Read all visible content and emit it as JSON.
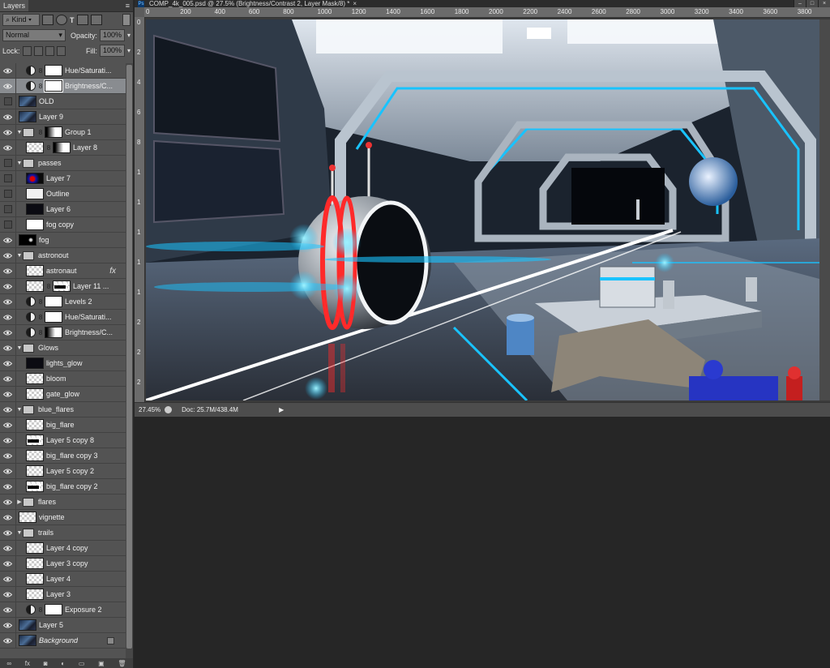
{
  "panel": {
    "tab": "Layers",
    "filter_kind": "Kind",
    "blend_mode": "Normal",
    "opacity_label": "Opacity:",
    "opacity_value": "100%",
    "lock_label": "Lock:",
    "fill_label": "Fill:",
    "fill_value": "100%"
  },
  "layers": [
    {
      "name": "Hue/Saturati...",
      "type": "adjustment",
      "visible": true,
      "indent": 1,
      "thumb": "mask"
    },
    {
      "name": "Brightness/C...",
      "type": "adjustment",
      "visible": true,
      "indent": 1,
      "thumb": "mask-sel",
      "selected": true
    },
    {
      "name": "OLD",
      "type": "pixel",
      "visible": false,
      "indent": 0,
      "thumb": "scene"
    },
    {
      "name": "Layer 9",
      "type": "pixel",
      "visible": true,
      "indent": 0,
      "thumb": "scene"
    },
    {
      "name": "Group 1",
      "type": "group",
      "visible": true,
      "indent": 0,
      "expanded": true,
      "mask": "mask-grad"
    },
    {
      "name": "Layer 8",
      "type": "pixel-masked",
      "visible": true,
      "indent": 1,
      "thumb": "checker",
      "mask": "mask-grad"
    },
    {
      "name": "passes",
      "type": "group",
      "visible": false,
      "indent": 0,
      "expanded": true
    },
    {
      "name": "Layer 7",
      "type": "pixel",
      "visible": false,
      "indent": 1,
      "thumb": "red"
    },
    {
      "name": "Outline",
      "type": "pixel",
      "visible": false,
      "indent": 1,
      "thumb": "white"
    },
    {
      "name": "Layer 6",
      "type": "pixel",
      "visible": false,
      "indent": 1,
      "thumb": "dark"
    },
    {
      "name": "fog copy",
      "type": "pixel",
      "visible": false,
      "indent": 1,
      "thumb": "fogthumb"
    },
    {
      "name": "fog",
      "type": "pixel",
      "visible": true,
      "indent": 0,
      "thumb": "mostly-black"
    },
    {
      "name": "astronout",
      "type": "group",
      "visible": true,
      "indent": 0,
      "expanded": true
    },
    {
      "name": "astronaut",
      "type": "pixel",
      "visible": true,
      "indent": 1,
      "thumb": "checker",
      "fx": "fx"
    },
    {
      "name": "Layer 11 ...",
      "type": "pixel-masked",
      "visible": true,
      "indent": 1,
      "thumb": "checker",
      "mask": "checker-bar"
    },
    {
      "name": "Levels 2",
      "type": "adjustment",
      "visible": true,
      "indent": 1,
      "thumb": "mask"
    },
    {
      "name": "Hue/Saturati...",
      "type": "adjustment",
      "visible": true,
      "indent": 1,
      "thumb": "mask"
    },
    {
      "name": "Brightness/C...",
      "type": "adjustment",
      "visible": true,
      "indent": 1,
      "thumb": "mask-grad"
    },
    {
      "name": "Glows",
      "type": "group",
      "visible": true,
      "indent": 0,
      "expanded": true
    },
    {
      "name": "lights_glow",
      "type": "pixel",
      "visible": true,
      "indent": 1,
      "thumb": "dark"
    },
    {
      "name": "bloom",
      "type": "pixel",
      "visible": true,
      "indent": 1,
      "thumb": "checker"
    },
    {
      "name": "gate_glow",
      "type": "pixel",
      "visible": true,
      "indent": 1,
      "thumb": "checker"
    },
    {
      "name": "blue_flares",
      "type": "group",
      "visible": true,
      "indent": 0,
      "expanded": true
    },
    {
      "name": "big_flare",
      "type": "pixel",
      "visible": true,
      "indent": 1,
      "thumb": "checker"
    },
    {
      "name": "Layer 5 copy 8",
      "type": "pixel",
      "visible": true,
      "indent": 1,
      "thumb": "checker-bar"
    },
    {
      "name": "big_flare copy 3",
      "type": "pixel",
      "visible": true,
      "indent": 1,
      "thumb": "checker"
    },
    {
      "name": "Layer 5 copy 2",
      "type": "pixel",
      "visible": true,
      "indent": 1,
      "thumb": "checker"
    },
    {
      "name": "big_flare copy 2",
      "type": "pixel",
      "visible": true,
      "indent": 1,
      "thumb": "checker-bar"
    },
    {
      "name": "flares",
      "type": "group",
      "visible": true,
      "indent": 0,
      "expanded": false
    },
    {
      "name": "vignette",
      "type": "pixel",
      "visible": true,
      "indent": 0,
      "thumb": "checker"
    },
    {
      "name": "trails",
      "type": "group",
      "visible": true,
      "indent": 0,
      "expanded": true
    },
    {
      "name": "Layer 4 copy",
      "type": "pixel",
      "visible": true,
      "indent": 1,
      "thumb": "checker"
    },
    {
      "name": "Layer 3 copy",
      "type": "pixel",
      "visible": true,
      "indent": 1,
      "thumb": "checker"
    },
    {
      "name": "Layer 4",
      "type": "pixel",
      "visible": true,
      "indent": 1,
      "thumb": "checker"
    },
    {
      "name": "Layer 3",
      "type": "pixel",
      "visible": true,
      "indent": 1,
      "thumb": "checker"
    },
    {
      "name": "Exposure 2",
      "type": "adjustment",
      "visible": true,
      "indent": 1,
      "thumb": "mask"
    },
    {
      "name": "Layer 5",
      "type": "pixel",
      "visible": true,
      "indent": 0,
      "thumb": "scene"
    },
    {
      "name": "Background",
      "type": "pixel",
      "visible": true,
      "indent": 0,
      "thumb": "scene",
      "italic": true,
      "locked": true
    }
  ],
  "document": {
    "title": "COMP_4k_005.psd @ 27.5% (Brightness/Contrast 2, Layer Mask/8) *",
    "close": "×",
    "zoom": "27.45%",
    "doc_size": "Doc: 25.7M/438.4M",
    "ruler_top": [
      "0",
      "200",
      "400",
      "600",
      "800",
      "1000",
      "1200",
      "1400",
      "1600",
      "1800",
      "2000",
      "2200",
      "2400",
      "2600",
      "2800",
      "3000",
      "3200",
      "3400",
      "3600",
      "3800"
    ],
    "ruler_left": [
      "0",
      "2",
      "4",
      "6",
      "8",
      "1",
      "1",
      "1",
      "1",
      "1",
      "2",
      "2",
      "2"
    ]
  },
  "colors": {
    "panel_bg": "#535353",
    "selected_row": "#898c90",
    "accent_cyan": "#19c3ff",
    "accent_red": "#ff2a2a"
  }
}
